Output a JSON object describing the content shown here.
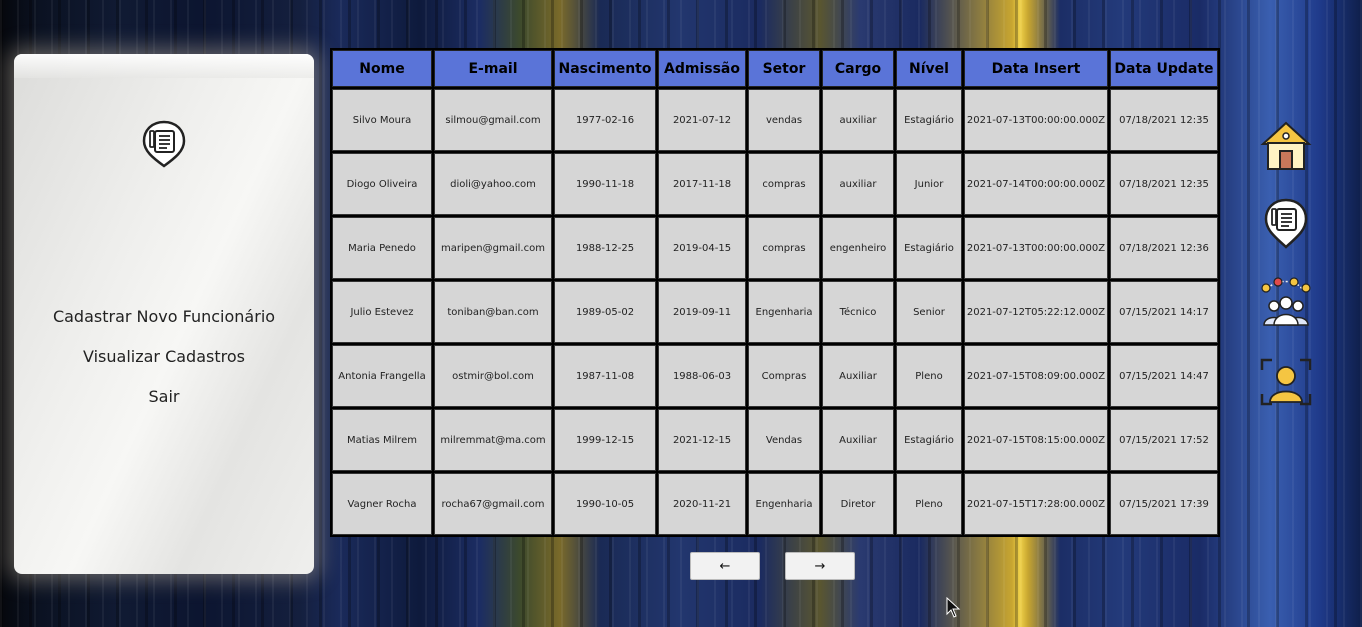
{
  "sidebar": {
    "menu": [
      {
        "label": "Cadastrar Novo Funcionário"
      },
      {
        "label": "Visualizar Cadastros"
      },
      {
        "label": "Sair"
      }
    ],
    "logo_icon": "document-pin-icon"
  },
  "table": {
    "headers": [
      "Nome",
      "E-mail",
      "Nascimento",
      "Admissão",
      "Setor",
      "Cargo",
      "Nível",
      "Data Insert",
      "Data Update"
    ],
    "rows": [
      [
        "Silvo Moura",
        "silmou@gmail.com",
        "1977-02-16",
        "2021-07-12",
        "vendas",
        "auxiliar",
        "Estagiário",
        "2021-07-13T00:00:00.000Z",
        "07/18/2021 12:35"
      ],
      [
        "Diogo Oliveira",
        "dioli@yahoo.com",
        "1990-11-18",
        "2017-11-18",
        "compras",
        "auxiliar",
        "Junior",
        "2021-07-14T00:00:00.000Z",
        "07/18/2021 12:35"
      ],
      [
        "Maria Penedo",
        "maripen@gmail.com",
        "1988-12-25",
        "2019-04-15",
        "compras",
        "engenheiro",
        "Estagiário",
        "2021-07-13T00:00:00.000Z",
        "07/18/2021 12:36"
      ],
      [
        "Julio Estevez",
        "toniban@ban.com",
        "1989-05-02",
        "2019-09-11",
        "Engenharia",
        "Técnico",
        "Senior",
        "2021-07-12T05:22:12.000Z",
        "07/15/2021 14:17"
      ],
      [
        "Antonia Frangella",
        "ostmir@bol.com",
        "1987-11-08",
        "1988-06-03",
        "Compras",
        "Auxiliar",
        "Pleno",
        "2021-07-15T08:09:00.000Z",
        "07/15/2021 14:47"
      ],
      [
        "Matias Milrem",
        "milremmat@ma.com",
        "1999-12-15",
        "2021-12-15",
        "Vendas",
        "Auxiliar",
        "Estagiário",
        "2021-07-15T08:15:00.000Z",
        "07/15/2021 17:52"
      ],
      [
        "Vagner Rocha",
        "rocha67@gmail.com",
        "1990-10-05",
        "2020-11-21",
        "Engenharia",
        "Diretor",
        "Pleno",
        "2021-07-15T17:28:00.000Z",
        "07/15/2021 17:39"
      ]
    ]
  },
  "pagination": {
    "prev_label": "←",
    "next_label": "→"
  },
  "right_nav": {
    "icons": [
      "home-icon",
      "document-pin-icon",
      "team-icon",
      "profile-scan-icon"
    ]
  },
  "colors": {
    "header_bg": "#5a74d8",
    "cell_bg": "#d6d6d6",
    "panel_bg": "#f0f0ee"
  }
}
